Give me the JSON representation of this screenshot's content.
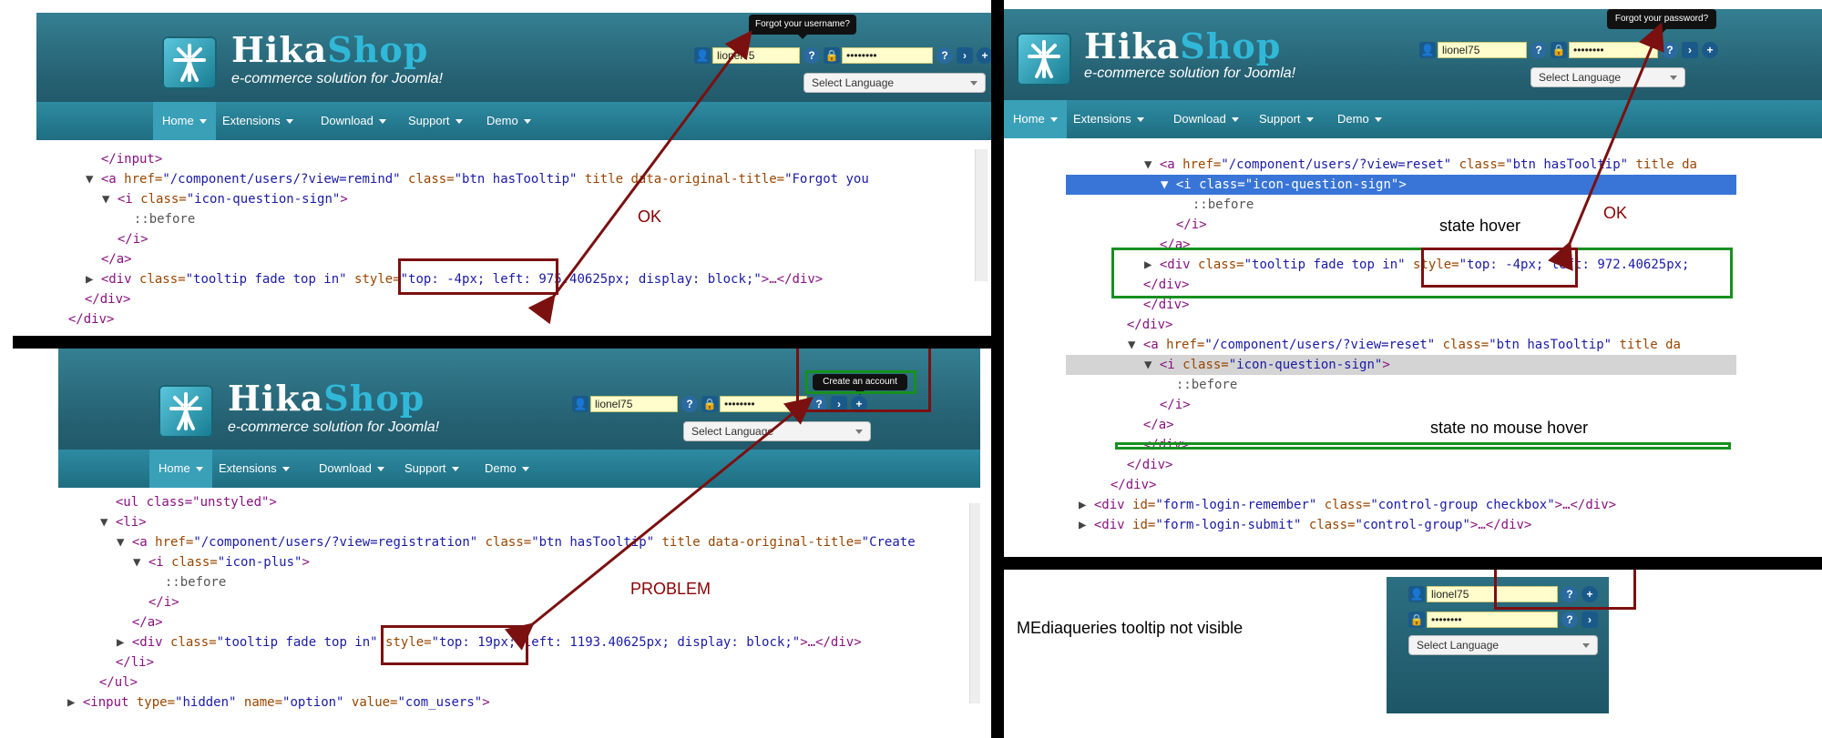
{
  "brand": {
    "name_part1": "Hika",
    "name_part2": "Shop",
    "tagline": "e-commerce solution for Joomla!"
  },
  "nav": [
    "Home",
    "Extensions",
    "Download",
    "Support",
    "Demo"
  ],
  "login": {
    "username": "lionel75",
    "password": "••••••••",
    "language_placeholder": "Select Language"
  },
  "panel1": {
    "tooltip": "Forgot your username?",
    "annotation": "OK",
    "code": [
      {
        "indent": 0,
        "tri": "",
        "parts": [
          [
            "t",
            "</input>"
          ]
        ]
      },
      {
        "indent": 0,
        "tri": "▼",
        "parts": [
          [
            "t",
            "<a "
          ],
          [
            "a",
            "href="
          ],
          [
            "v",
            "\"/component/users/?view=remind\""
          ],
          [
            "a",
            " class="
          ],
          [
            "v",
            "\"btn hasTooltip\""
          ],
          [
            "a",
            " title data-original-title="
          ],
          [
            "v",
            "\"Forgot you"
          ]
        ]
      },
      {
        "indent": 1,
        "tri": "▼",
        "parts": [
          [
            "t",
            "<i "
          ],
          [
            "a",
            "class="
          ],
          [
            "v",
            "\"icon-question-sign\""
          ],
          [
            "t",
            ">"
          ]
        ]
      },
      {
        "indent": 2,
        "tri": "",
        "parts": [
          [
            "p",
            "::before"
          ]
        ]
      },
      {
        "indent": 1,
        "tri": "",
        "parts": [
          [
            "t",
            "</i>"
          ]
        ]
      },
      {
        "indent": 0,
        "tri": "",
        "parts": [
          [
            "t",
            "</a>"
          ]
        ]
      },
      {
        "indent": 0,
        "tri": "▶",
        "parts": [
          [
            "t",
            "<div "
          ],
          [
            "a",
            "class="
          ],
          [
            "v",
            "\"tooltip fade top in\""
          ],
          [
            "a",
            " style="
          ],
          [
            "v",
            "\"top: -4px; left: 975.40625px; display: block;\""
          ],
          [
            "t",
            ">…</div>"
          ]
        ]
      },
      {
        "indent": -1,
        "tri": "",
        "parts": [
          [
            "t",
            "</div>"
          ]
        ]
      },
      {
        "indent": -2,
        "tri": "",
        "parts": [
          [
            "t",
            "</div>"
          ]
        ]
      }
    ]
  },
  "panel2": {
    "tooltip": "Create an account",
    "annotation": "PROBLEM",
    "code": [
      {
        "indent": 0,
        "tri": "",
        "parts": [
          [
            "t",
            "<ul class=\"unstyled\">"
          ]
        ]
      },
      {
        "indent": 0,
        "tri": "▼",
        "parts": [
          [
            "t",
            "<li>"
          ]
        ]
      },
      {
        "indent": 1,
        "tri": "▼",
        "parts": [
          [
            "t",
            "<a "
          ],
          [
            "a",
            "href="
          ],
          [
            "v",
            "\"/component/users/?view=registration\""
          ],
          [
            "a",
            " class="
          ],
          [
            "v",
            "\"btn hasTooltip\""
          ],
          [
            "a",
            " title data-original-title="
          ],
          [
            "v",
            "\"Create"
          ]
        ]
      },
      {
        "indent": 2,
        "tri": "▼",
        "parts": [
          [
            "t",
            "<i "
          ],
          [
            "a",
            "class="
          ],
          [
            "v",
            "\"icon-plus\""
          ],
          [
            "t",
            ">"
          ]
        ]
      },
      {
        "indent": 3,
        "tri": "",
        "parts": [
          [
            "p",
            "::before"
          ]
        ]
      },
      {
        "indent": 2,
        "tri": "",
        "parts": [
          [
            "t",
            "</i>"
          ]
        ]
      },
      {
        "indent": 1,
        "tri": "",
        "parts": [
          [
            "t",
            "</a>"
          ]
        ]
      },
      {
        "indent": 1,
        "tri": "▶",
        "parts": [
          [
            "t",
            "<div "
          ],
          [
            "a",
            "class="
          ],
          [
            "v",
            "\"tooltip fade top in\""
          ],
          [
            "a",
            " style="
          ],
          [
            "v",
            "\"top: 19px; left: 1193.40625px; display: block;\""
          ],
          [
            "t",
            ">…</div>"
          ]
        ]
      },
      {
        "indent": 0,
        "tri": "",
        "parts": [
          [
            "t",
            "</li>"
          ]
        ]
      },
      {
        "indent": -1,
        "tri": "",
        "parts": [
          [
            "t",
            "</ul>"
          ]
        ]
      },
      {
        "indent": -2,
        "tri": "▶",
        "parts": [
          [
            "t",
            "<input "
          ],
          [
            "a",
            "type="
          ],
          [
            "v",
            "\"hidden\""
          ],
          [
            "a",
            " name="
          ],
          [
            "v",
            "\"option\""
          ],
          [
            "a",
            " value="
          ],
          [
            "v",
            "\"com_users\""
          ],
          [
            "t",
            ">"
          ]
        ]
      }
    ]
  },
  "panel3": {
    "tooltip": "Forgot your password?",
    "annotation_ok": "OK",
    "annotation_hover": "state hover",
    "annotation_nohover": "state no mouse hover",
    "code": [
      {
        "indent": 2,
        "tri": "▼",
        "row": "",
        "parts": [
          [
            "t",
            "<a "
          ],
          [
            "a",
            "href="
          ],
          [
            "v",
            "\"/component/users/?view=reset\""
          ],
          [
            "a",
            " class="
          ],
          [
            "v",
            "\"btn hasTooltip\""
          ],
          [
            "a",
            " title da"
          ]
        ]
      },
      {
        "indent": 3,
        "tri": "▼",
        "row": "sel",
        "parts": [
          [
            "t",
            "<i "
          ],
          [
            "a",
            "class="
          ],
          [
            "v",
            "\"icon-question-sign\""
          ],
          [
            "t",
            ">"
          ]
        ]
      },
      {
        "indent": 4,
        "tri": "",
        "row": "",
        "parts": [
          [
            "p",
            "::before"
          ]
        ]
      },
      {
        "indent": 3,
        "tri": "",
        "row": "",
        "parts": [
          [
            "t",
            "</i>"
          ]
        ]
      },
      {
        "indent": 2,
        "tri": "",
        "row": "",
        "parts": [
          [
            "t",
            "</a>"
          ]
        ]
      },
      {
        "indent": 2,
        "tri": "▶",
        "row": "",
        "parts": [
          [
            "t",
            "<div "
          ],
          [
            "a",
            "class="
          ],
          [
            "v",
            "\"tooltip fade top in\""
          ],
          [
            "a",
            " style="
          ],
          [
            "v",
            "\"top: -4px; left: 972.40625px;"
          ]
        ]
      },
      {
        "indent": 1,
        "tri": "",
        "row": "",
        "parts": [
          [
            "t",
            "</div>"
          ]
        ]
      },
      {
        "indent": 1,
        "tri": "",
        "row": "",
        "parts": [
          [
            "t",
            "</div>"
          ]
        ]
      },
      {
        "indent": 0,
        "tri": "",
        "row": "",
        "parts": [
          [
            "t",
            "</div>"
          ]
        ]
      },
      {
        "indent": 1,
        "tri": "▼",
        "row": "",
        "parts": [
          [
            "t",
            "<a "
          ],
          [
            "a",
            "href="
          ],
          [
            "v",
            "\"/component/users/?view=reset\""
          ],
          [
            "a",
            " class="
          ],
          [
            "v",
            "\"btn hasTooltip\""
          ],
          [
            "a",
            " title da"
          ]
        ]
      },
      {
        "indent": 2,
        "tri": "▼",
        "row": "gray",
        "parts": [
          [
            "t",
            "<i "
          ],
          [
            "a",
            "class="
          ],
          [
            "v",
            "\"icon-question-sign\""
          ],
          [
            "t",
            ">"
          ]
        ]
      },
      {
        "indent": 3,
        "tri": "",
        "row": "",
        "parts": [
          [
            "p",
            "::before"
          ]
        ]
      },
      {
        "indent": 2,
        "tri": "",
        "row": "",
        "parts": [
          [
            "t",
            "</i>"
          ]
        ]
      },
      {
        "indent": 1,
        "tri": "",
        "row": "",
        "parts": [
          [
            "t",
            "</a>"
          ]
        ]
      },
      {
        "indent": 1,
        "tri": "",
        "row": "",
        "parts": [
          [
            "t",
            "</div>"
          ]
        ]
      },
      {
        "indent": 0,
        "tri": "",
        "row": "",
        "parts": [
          [
            "t",
            "</div>"
          ]
        ]
      },
      {
        "indent": -1,
        "tri": "",
        "row": "",
        "parts": [
          [
            "t",
            "</div>"
          ]
        ]
      },
      {
        "indent": -2,
        "tri": "▶",
        "row": "",
        "parts": [
          [
            "t",
            "<div "
          ],
          [
            "a",
            "id="
          ],
          [
            "v",
            "\"form-login-remember\""
          ],
          [
            "a",
            " class="
          ],
          [
            "v",
            "\"control-group checkbox\""
          ],
          [
            "t",
            ">…</div>"
          ]
        ]
      },
      {
        "indent": -2,
        "tri": "▶",
        "row": "",
        "parts": [
          [
            "t",
            "<div "
          ],
          [
            "a",
            "id="
          ],
          [
            "v",
            "\"form-login-submit\""
          ],
          [
            "a",
            " class="
          ],
          [
            "v",
            "\"control-group\""
          ],
          [
            "t",
            ">…</div>"
          ]
        ]
      }
    ]
  },
  "panel4": {
    "annotation": "MEdiaqueries tooltip not visible"
  }
}
